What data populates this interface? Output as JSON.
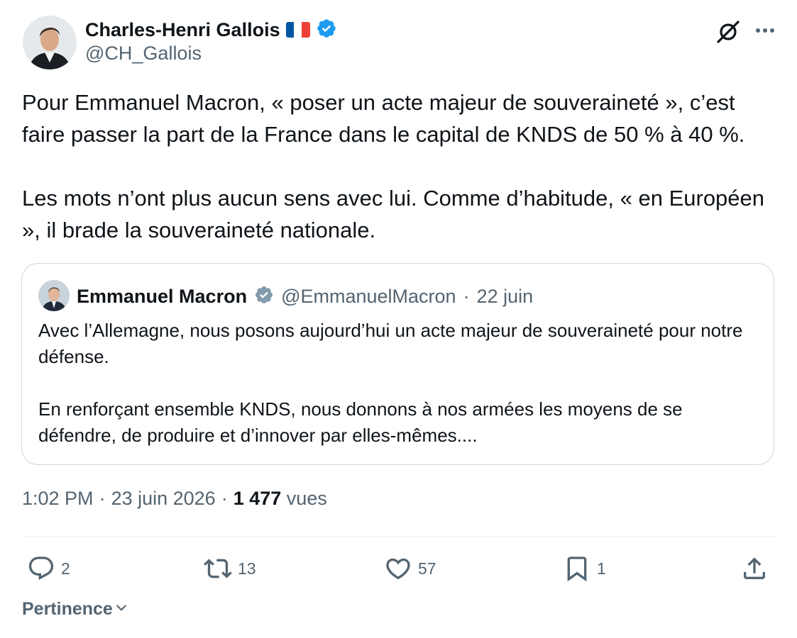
{
  "author": {
    "name": "Charles-Henri Gallois",
    "handle": "@CH_Gallois",
    "verified": true,
    "flag_colors": [
      "#0055a4",
      "#ffffff",
      "#ef4135"
    ]
  },
  "tweet": {
    "paragraphs": [
      "Pour Emmanuel Macron, « poser un acte majeur de souveraineté », c’est faire passer la part de la France dans le capital de KNDS de 50 % à 40 %.",
      "Les mots n’ont plus aucun sens avec lui. Comme d’habitude, « en Européen », il brade la souveraineté nationale."
    ],
    "time": "1:02 PM",
    "date": "23 juin 2026",
    "views_count": "1 477",
    "views_label": "vues"
  },
  "quote": {
    "name": "Emmanuel Macron",
    "handle": "@EmmanuelMacron",
    "separator": "·",
    "date": "22 juin",
    "verified_badge": "gray-check-badge-icon",
    "paragraphs": [
      "Avec l’Allemagne, nous posons aujourd’hui un acte majeur de souveraineté pour notre défense.",
      "En renforçant ensemble KNDS, nous donnons à nos armées les moyens de se défendre, de produire et d’innover par elles-mêmes...."
    ]
  },
  "actions": {
    "reply_count": "2",
    "retweet_count": "13",
    "like_count": "57",
    "bookmark_count": "1"
  },
  "sort": {
    "label": "Pertinence"
  },
  "colors": {
    "text": "#0f1419",
    "secondary": "#536471",
    "verified_blue": "#1d9bf0",
    "border": "#cfd9de"
  }
}
